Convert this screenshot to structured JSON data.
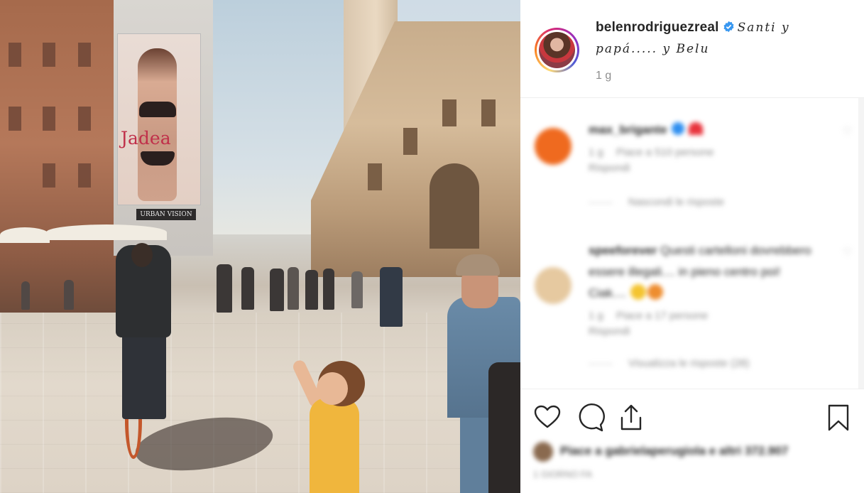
{
  "photo": {
    "billboard_brand": "Jadea",
    "billboard_footer": "URBAN VISION"
  },
  "post": {
    "username": "belenrodriguezreal",
    "verified_icon": "verified-badge-icon",
    "caption": "Santi y papá..... y Belu",
    "timestamp": "1 g"
  },
  "comments": [
    {
      "user": "max_brigante",
      "text": "",
      "meta_time": "1 g",
      "meta_likes": "Piace a 510 persone",
      "reply": "Rispondi",
      "view_replies": "Nascondi le risposte",
      "avatar_color": "#ef6a1f"
    },
    {
      "user": "speeforever",
      "text": "Questi cartelloni dovrebbero essere illegali.... in pieno centro poi! Ciak....",
      "meta_time": "1 g",
      "meta_likes": "Piace a 17 persone",
      "reply": "Rispondi",
      "view_replies": "Visualizza le risposte (28)",
      "avatar_color": "#e6c9a0"
    }
  ],
  "actions": {
    "like_icon": "heart-icon",
    "comment_icon": "comment-icon",
    "share_icon": "share-icon",
    "save_icon": "bookmark-icon",
    "likes_text": "Piace a gabrielaperugiola e altri 372.907",
    "date": "1 GIORNO FA"
  },
  "colors": {
    "text": "#262626",
    "secondary": "#8e8e8e",
    "verified": "#3897f0",
    "divider": "#efefef"
  }
}
